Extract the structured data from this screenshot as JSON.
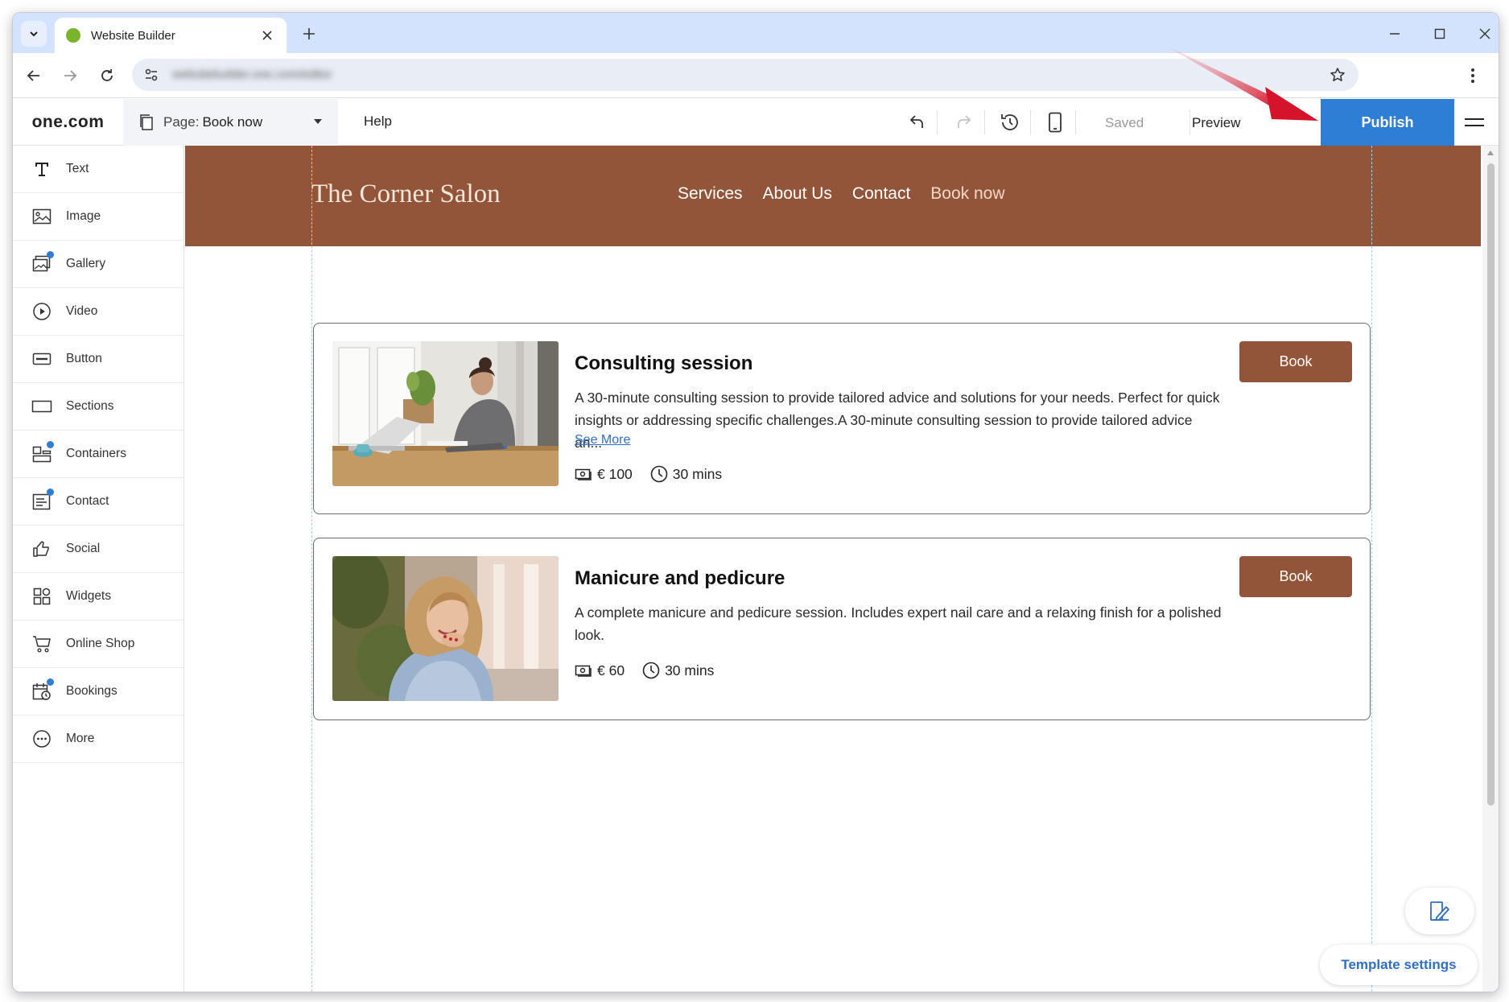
{
  "browser": {
    "tab_title": "Website Builder",
    "url": "websitebuilder.one.com/editor"
  },
  "builder": {
    "logo": "one.com",
    "page_label": "Page:",
    "page_value": "Book now",
    "help": "Help",
    "saved": "Saved",
    "preview": "Preview",
    "publish": "Publish",
    "accent_color": "#2f7ed6"
  },
  "sidebar": {
    "items": [
      {
        "label": "Text",
        "icon": "text-icon"
      },
      {
        "label": "Image",
        "icon": "image-icon"
      },
      {
        "label": "Gallery",
        "icon": "gallery-icon"
      },
      {
        "label": "Video",
        "icon": "video-icon"
      },
      {
        "label": "Button",
        "icon": "button-icon"
      },
      {
        "label": "Sections",
        "icon": "sections-icon"
      },
      {
        "label": "Containers",
        "icon": "containers-icon"
      },
      {
        "label": "Contact",
        "icon": "contact-icon"
      },
      {
        "label": "Social",
        "icon": "thumbs-up-icon"
      },
      {
        "label": "Widgets",
        "icon": "widgets-icon"
      },
      {
        "label": "Online Shop",
        "icon": "cart-icon"
      },
      {
        "label": "Bookings",
        "icon": "calendar-clock-icon"
      },
      {
        "label": "More",
        "icon": "more-icon"
      }
    ]
  },
  "site": {
    "title": "The Corner Salon",
    "brand_color": "#93553a",
    "nav": [
      "Services",
      "About Us",
      "Contact",
      "Book now"
    ],
    "services": [
      {
        "title": "Consulting session",
        "description": "A 30-minute consulting session to provide tailored advice and solutions for your needs. Perfect for quick insights or addressing specific challenges.A 30-minute consulting session to provide tailored advice an...",
        "see_more": "See More",
        "price": "€ 100",
        "duration": "30 mins",
        "button": "Book"
      },
      {
        "title": "Manicure and pedicure",
        "description": "A complete manicure and pedicure session. Includes expert nail care and a relaxing finish for a polished look.",
        "price": "€ 60",
        "duration": "30 mins",
        "button": "Book"
      }
    ]
  },
  "floating": {
    "template_settings": "Template settings"
  }
}
